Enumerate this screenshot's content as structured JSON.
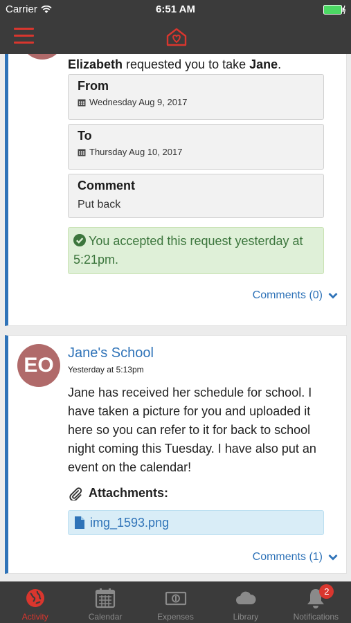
{
  "status_bar": {
    "carrier": "Carrier",
    "time": "6:51 AM"
  },
  "colors": {
    "accent": "#d9362e",
    "link": "#2f73b8",
    "bar": "#3b3b3b",
    "success_bg": "#dff0d8",
    "success_text": "#3c763d",
    "avatar": "#b06a6a"
  },
  "request_card": {
    "requester": "Elizabeth",
    "requested_text": " requested you to take ",
    "child": "Jane",
    "period": ".",
    "from": {
      "title": "From",
      "date": "Wednesday Aug 9, 2017",
      "icon": "calendar-icon"
    },
    "to": {
      "title": "To",
      "date": "Thursday Aug 10, 2017",
      "icon": "calendar-icon"
    },
    "comment": {
      "title": "Comment",
      "text": "Put back"
    },
    "alert_text": "You accepted this request yesterday at 5:21pm.",
    "comments_label": "Comments (0)"
  },
  "post_card": {
    "avatar_initials": "EO",
    "author": "Jane's School",
    "timestamp": "Yesterday at 5:13pm",
    "body": "Jane has received her schedule for school. I have taken a picture for you and uploaded it here so you can refer to it for back to school night coming this Tuesday. I have also put an event on the calendar!",
    "attachments_label": "Attachments:",
    "file_name": "img_1593.png",
    "comments_label": "Comments (1)"
  },
  "tabs": [
    {
      "label": "Activity",
      "icon": "globe-icon",
      "active": true
    },
    {
      "label": "Calendar",
      "icon": "calendar-icon"
    },
    {
      "label": "Expenses",
      "icon": "money-icon"
    },
    {
      "label": "Library",
      "icon": "cloud-icon"
    },
    {
      "label": "Notifications",
      "icon": "bell-icon",
      "badge": "2"
    }
  ]
}
